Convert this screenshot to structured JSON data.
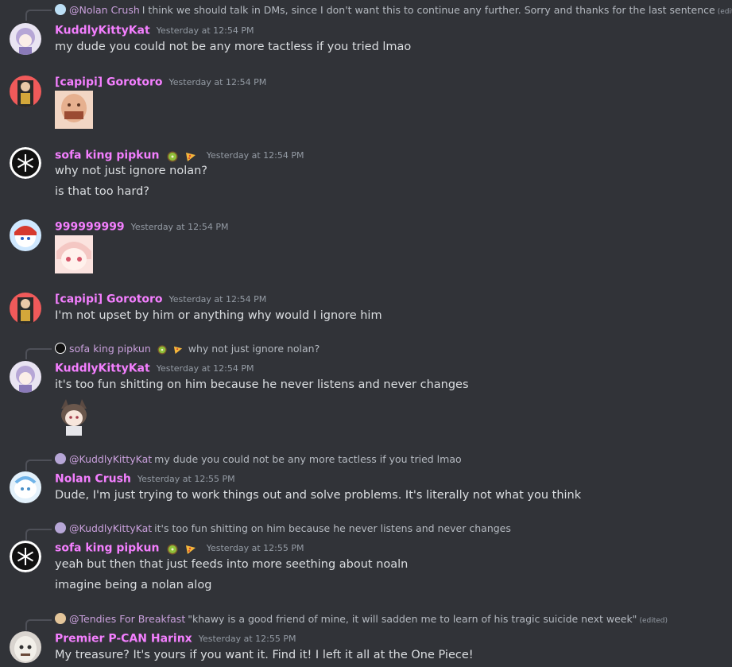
{
  "messages": [
    {
      "reply": {
        "name": "@Nolan Crush",
        "text": "I think we should talk in DMs, since I don't want this to continue any further. Sorry and thanks for the last sentence",
        "edited": "(edited)"
      },
      "author": "KuddlyKittyKat",
      "time": "Yesterday at 12:54 PM",
      "lines": [
        "my dude you could not be any more tactless if you tried lmao"
      ]
    },
    {
      "author": "[capipi] Gorotoro",
      "time": "Yesterday at 12:54 PM",
      "lines": []
    },
    {
      "author": "sofa king pipkun",
      "time": "Yesterday at 12:54 PM",
      "lines": [
        "why not just ignore nolan?",
        "is that too hard?"
      ]
    },
    {
      "author": "999999999",
      "time": "Yesterday at 12:54 PM",
      "lines": []
    },
    {
      "author": "[capipi] Gorotoro",
      "time": "Yesterday at 12:54 PM",
      "lines": [
        "I'm not upset by him or anything why would I ignore him"
      ]
    },
    {
      "reply": {
        "name": "sofa king pipkun",
        "text": "why not just ignore nolan?"
      },
      "author": "KuddlyKittyKat",
      "time": "Yesterday at 12:54 PM",
      "lines": [
        "it's too fun shitting on him because he never listens and never changes"
      ]
    },
    {
      "reply": {
        "name": "@KuddlyKittyKat",
        "text": "my dude you could not be any more tactless if you tried lmao"
      },
      "author": "Nolan Crush",
      "time": "Yesterday at 12:55 PM",
      "lines": [
        "Dude, I'm just trying to work things out and solve problems. It's literally not what you think"
      ]
    },
    {
      "reply": {
        "name": "@KuddlyKittyKat",
        "text": "it's too fun shitting on him because he never listens and never changes"
      },
      "author": "sofa king pipkun",
      "time": "Yesterday at 12:55 PM",
      "lines": [
        "yeah but then that just feeds into more seething about noaln",
        "imagine being a nolan alog"
      ]
    },
    {
      "reply": {
        "name": "@Tendies For Breakfast",
        "text": "\"khawy is a good friend of mine, it will sadden me to learn of his tragic suicide next week\"",
        "edited": "(edited)"
      },
      "author": "Premier P-CAN Harinx",
      "time": "Yesterday at 12:55 PM",
      "lines": [
        "My treasure? It's yours if you want it. Find it! I left it all at the One Piece!"
      ]
    }
  ],
  "colors": {
    "background": "#313338",
    "username": "#f47fff",
    "timestamp": "#949ba4",
    "text": "#dbdee1"
  }
}
